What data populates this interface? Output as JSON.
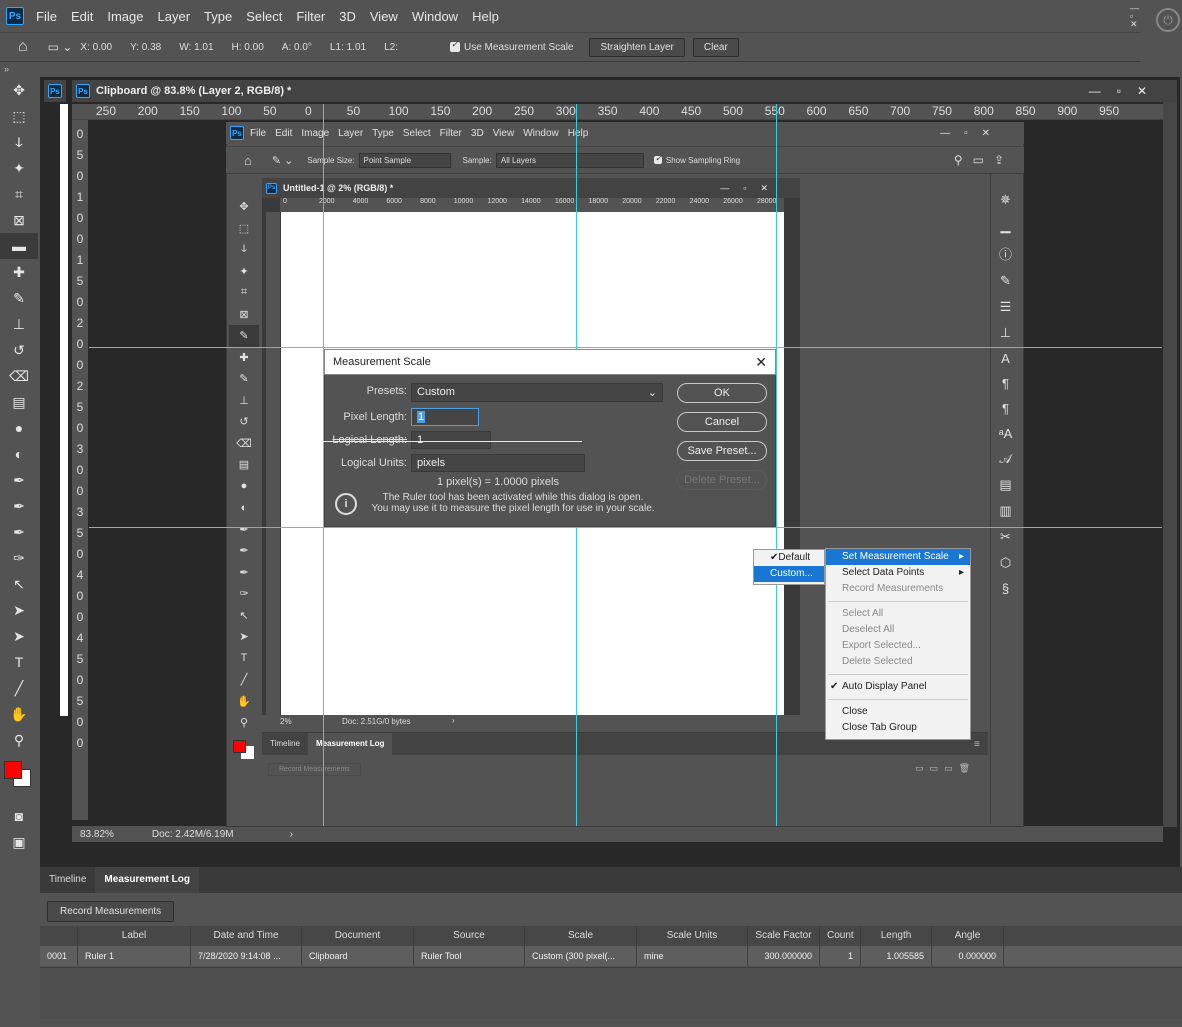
{
  "app": {
    "logo": "Ps",
    "menu": [
      "File",
      "Edit",
      "Image",
      "Layer",
      "Type",
      "Select",
      "Filter",
      "3D",
      "View",
      "Window",
      "Help"
    ]
  },
  "options_bar": {
    "x": "X: 0.00",
    "y": "Y: 0.38",
    "w": "W: 1.01",
    "h": "H: 0.00",
    "a": "A: 0.0°",
    "l1": "L1: 1.01",
    "l2": "L2:",
    "use_scale_label": "Use Measurement Scale",
    "straighten_label": "Straighten Layer",
    "clear_label": "Clear"
  },
  "document": {
    "tab_title": "Clipboard @ 83.8% (Layer 2, RGB/8) *",
    "ruler_h": [
      "250",
      "200",
      "150",
      "100",
      "50",
      "0",
      "50",
      "100",
      "150",
      "200",
      "250",
      "300",
      "350",
      "400",
      "450",
      "500",
      "550",
      "600",
      "650",
      "700",
      "750",
      "800",
      "850",
      "900",
      "950"
    ],
    "ruler_v": [
      "0",
      "5",
      "0",
      "1",
      "0",
      "0",
      "1",
      "5",
      "0",
      "2",
      "0",
      "0",
      "2",
      "5",
      "0",
      "3",
      "0",
      "0",
      "3",
      "5",
      "0",
      "4",
      "0",
      "0",
      "4",
      "5",
      "0",
      "5",
      "0",
      "0"
    ],
    "zoom": "83.82%",
    "doc_size": "Doc: 2.42M/6.19M"
  },
  "inner": {
    "logo": "Ps",
    "menu": [
      "File",
      "Edit",
      "Image",
      "Layer",
      "Type",
      "Select",
      "Filter",
      "3D",
      "View",
      "Window",
      "Help"
    ],
    "sample_size_label": "Sample Size:",
    "sample_size_value": "Point Sample",
    "sample_label": "Sample:",
    "sample_value": "All Layers",
    "sampling_ring_label": "Show Sampling Ring",
    "doc_tab": "Untitled-1 @ 2% (RGB/8) *",
    "ruler_h": [
      "0",
      "2000",
      "4000",
      "6000",
      "8000",
      "10000",
      "12000",
      "14000",
      "16000",
      "18000",
      "20000",
      "22000",
      "24000",
      "26000",
      "28000"
    ],
    "zoom": "2%",
    "doc_size": "Doc: 2.51G/0 bytes",
    "log_tabs": [
      "Timeline",
      "Measurement Log"
    ],
    "record_label": "Record Measurements"
  },
  "dialog": {
    "title": "Measurement Scale",
    "presets_label": "Presets:",
    "presets_value": "Custom",
    "pixel_length_label": "Pixel Length:",
    "pixel_length_value": "1",
    "logical_length_label": "Logical Length:",
    "logical_length_value": "1",
    "logical_units_label": "Logical Units:",
    "logical_units_value": "pixels",
    "ratio_text": "1 pixel(s) = 1.0000 pixels",
    "info_line1": "The Ruler tool has been activated while this dialog is open.",
    "info_line2": "You may use it to measure the pixel length for use in your scale.",
    "ok": "OK",
    "cancel": "Cancel",
    "save_preset": "Save Preset...",
    "delete_preset": "Delete Preset..."
  },
  "context_menu": {
    "set_scale": "Set Measurement Scale",
    "select_points": "Select Data Points",
    "record": "Record Measurements",
    "select_all": "Select All",
    "deselect_all": "Deselect All",
    "export": "Export Selected...",
    "delete": "Delete Selected",
    "auto_display": "Auto Display Panel",
    "close": "Close",
    "close_group": "Close Tab Group",
    "sub_default": "Default",
    "sub_custom": "Custom..."
  },
  "bottom_panel": {
    "tabs": [
      "Timeline",
      "Measurement Log"
    ],
    "record_button": "Record Measurements",
    "columns": [
      "",
      "Label",
      "Date and Time",
      "Document",
      "Source",
      "Scale",
      "Scale Units",
      "Scale Factor",
      "Count",
      "Length",
      "Angle"
    ],
    "row": [
      "0001",
      "Ruler 1",
      "7/28/2020 9:14:08 ...",
      "Clipboard",
      "Ruler Tool",
      "Custom (300 pixel(...",
      "mine",
      "300.000000",
      "1",
      "1.005585",
      "0.000000"
    ]
  },
  "colors": {
    "foreground": "#ff0000",
    "background": "#ffffff",
    "guide": "#35d0e8",
    "highlight": "#1976d2"
  }
}
